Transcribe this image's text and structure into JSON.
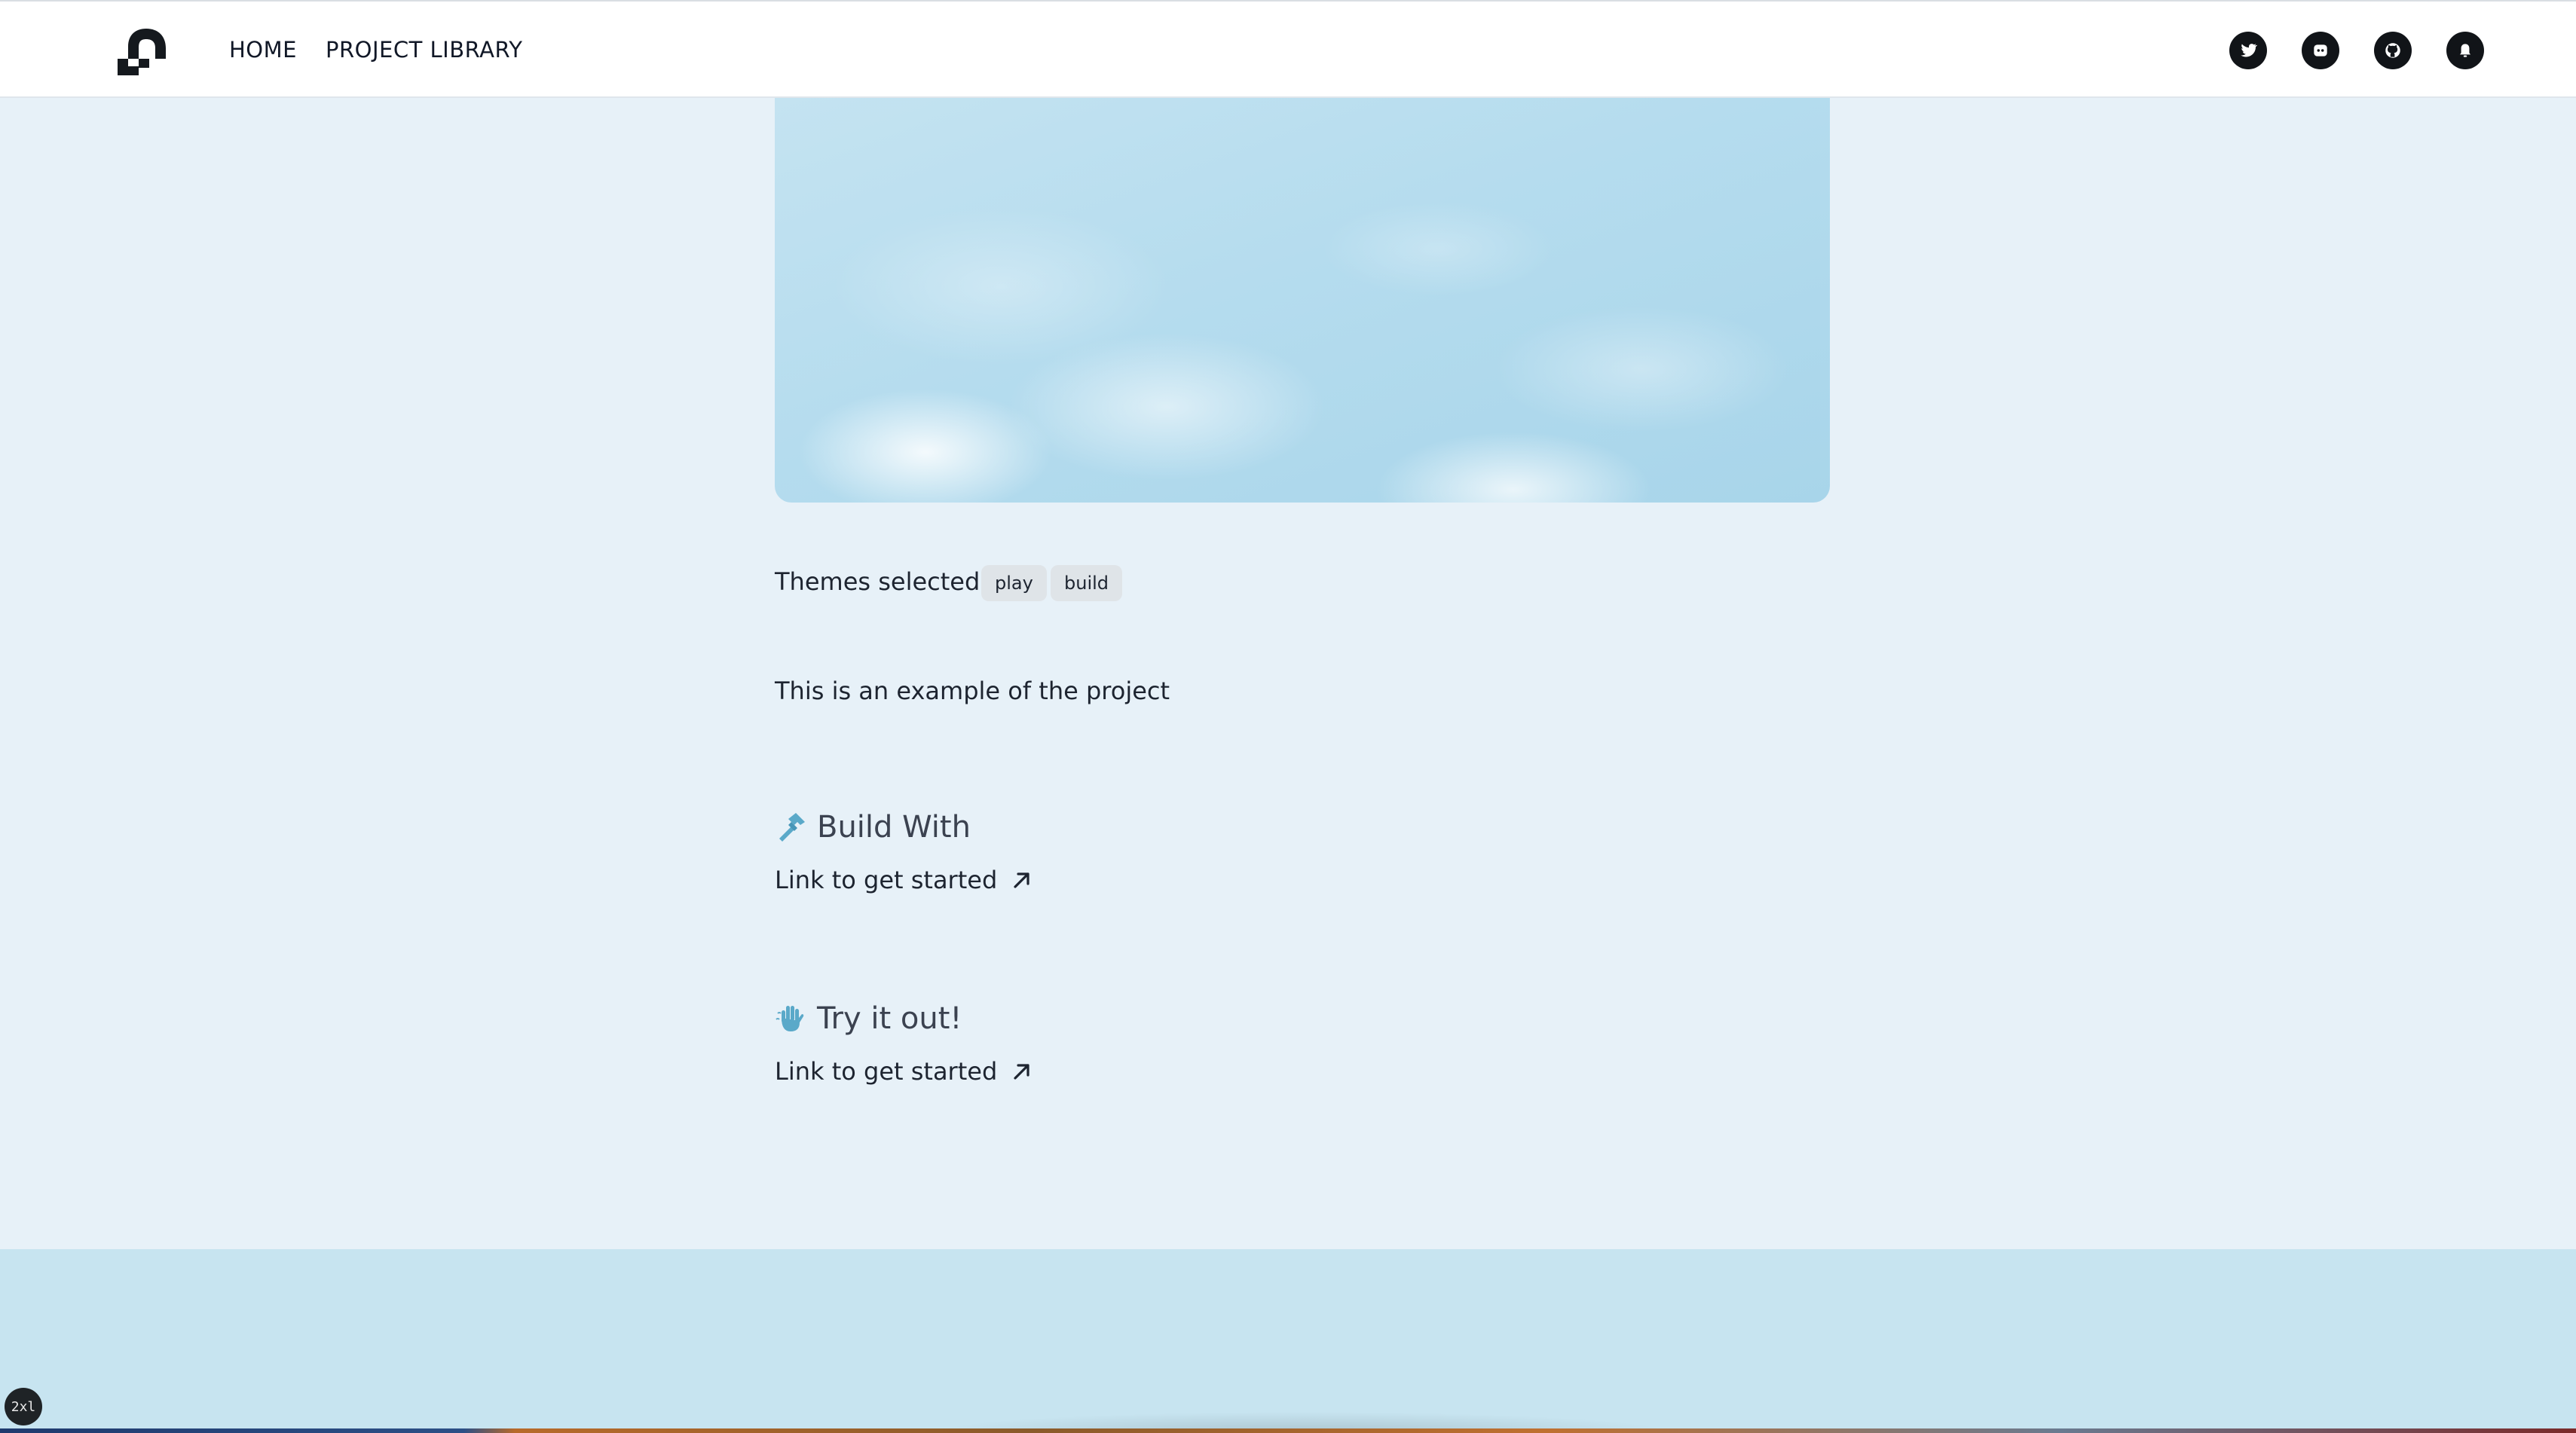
{
  "nav": {
    "home_label": "HOME",
    "library_label": "PROJECT LIBRARY",
    "social_icons": [
      "twitter-icon",
      "discord-icon",
      "github-icon",
      "notification-icon"
    ]
  },
  "hero": {
    "image": "sky-clouds"
  },
  "themes": {
    "label": "Themes selected",
    "tags": [
      "play",
      "build"
    ]
  },
  "description": "This is an example of the project",
  "build_section": {
    "icon": "hammer-icon",
    "title": "Build With",
    "link_label": "Link to get started"
  },
  "try_section": {
    "icon": "hand-icon",
    "title": "Try it out!",
    "link_label": "Link to get started"
  },
  "badge": "2xl",
  "colors": {
    "page_bg": "#e7f1f8",
    "footer_bg": "#c7e4f0",
    "accent_icon": "#5aa9c9",
    "text": "#1d2430"
  }
}
